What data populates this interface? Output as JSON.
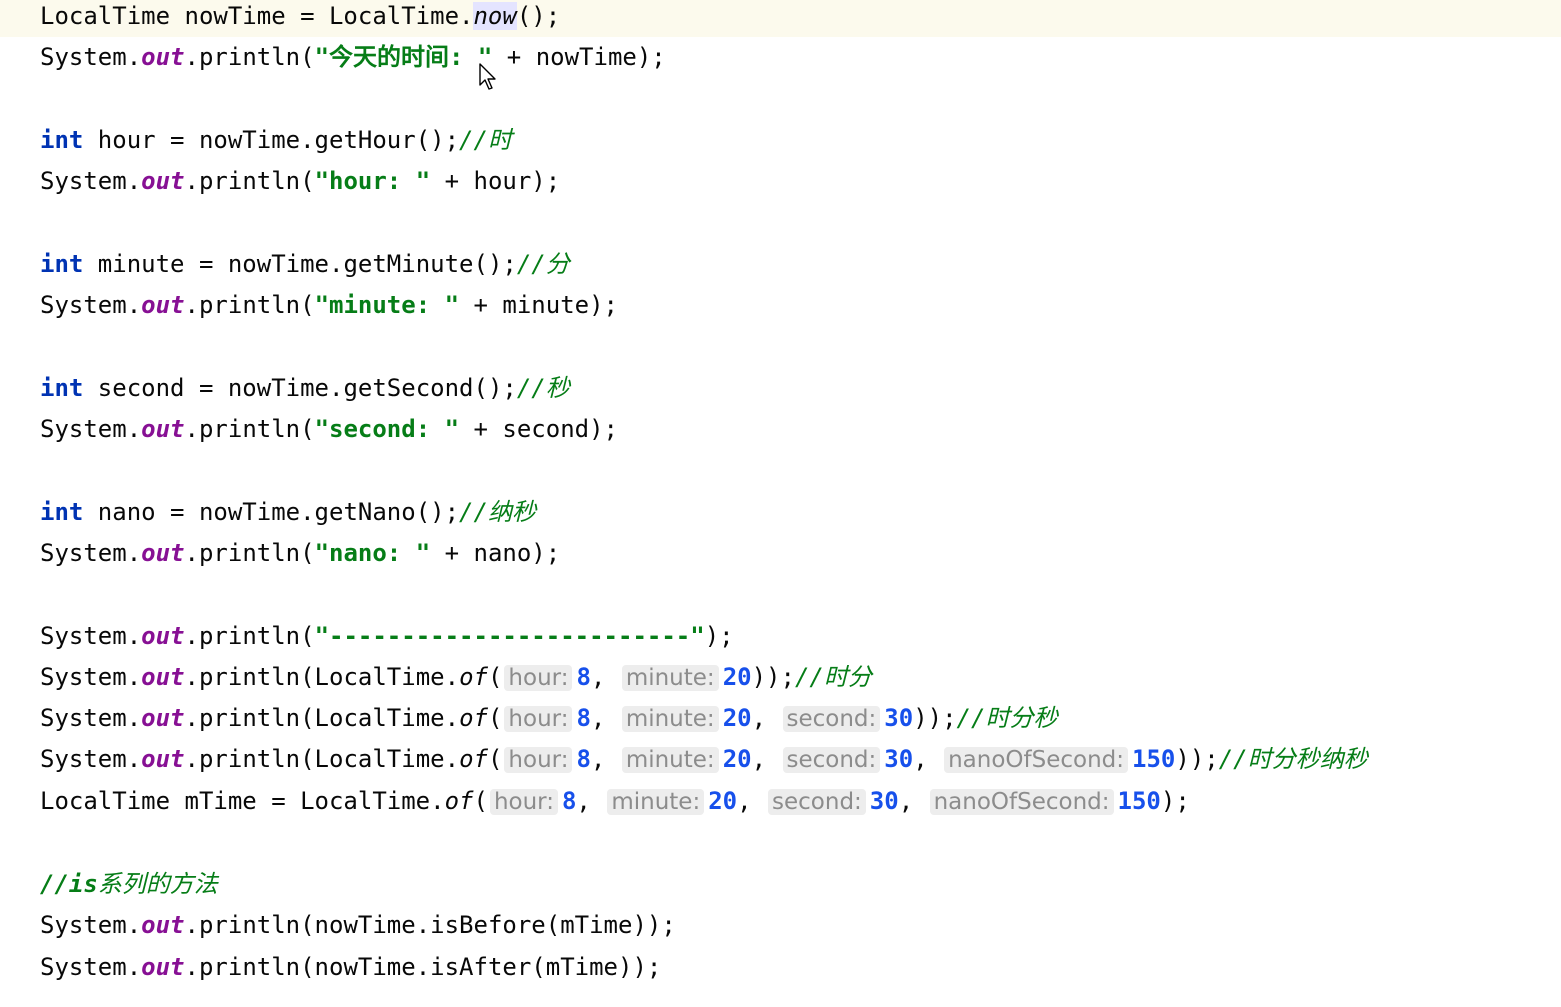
{
  "code": {
    "line1": {
      "t1": "LocalTime nowTime = LocalTime.",
      "m": "now",
      "t2": "();"
    },
    "line2": {
      "a": "System.",
      "f": "out",
      "b": ".println(",
      "s": "\"今天的时间: \"",
      "c": " + nowTime);"
    },
    "line4": {
      "kw": "int",
      "a": " hour = nowTime.getHour();",
      "cm": "//时"
    },
    "line5": {
      "a": "System.",
      "f": "out",
      "b": ".println(",
      "s": "\"hour: \"",
      "c": " + hour);"
    },
    "line7": {
      "kw": "int",
      "a": " minute = nowTime.getMinute();",
      "cm": "//分"
    },
    "line8": {
      "a": "System.",
      "f": "out",
      "b": ".println(",
      "s": "\"minute: \"",
      "c": " + minute);"
    },
    "line10": {
      "kw": "int",
      "a": " second = nowTime.getSecond();",
      "cm": "//秒"
    },
    "line11": {
      "a": "System.",
      "f": "out",
      "b": ".println(",
      "s": "\"second: \"",
      "c": " + second);"
    },
    "line13": {
      "kw": "int",
      "a": " nano = nowTime.getNano();",
      "cm": "//纳秒"
    },
    "line14": {
      "a": "System.",
      "f": "out",
      "b": ".println(",
      "s": "\"nano: \"",
      "c": " + nano);"
    },
    "line16": {
      "a": "System.",
      "f": "out",
      "b": ".println(",
      "s": "\"-------------------------\"",
      "c": ");"
    },
    "line17": {
      "a": "System.",
      "f": "out",
      "b": ".println(LocalTime.",
      "of": "of",
      "p": "(",
      "h1": "hour:",
      "v1": "8",
      "h2": "minute:",
      "v2": "20",
      "e": "));",
      "cm": "//时分"
    },
    "line18": {
      "a": "System.",
      "f": "out",
      "b": ".println(LocalTime.",
      "of": "of",
      "p": "(",
      "h1": "hour:",
      "v1": "8",
      "h2": "minute:",
      "v2": "20",
      "h3": "second:",
      "v3": "30",
      "e": "));",
      "cm": "//时分秒"
    },
    "line19": {
      "a": "System.",
      "f": "out",
      "b": ".println(LocalTime.",
      "of": "of",
      "p": "(",
      "h1": "hour:",
      "v1": "8",
      "h2": "minute:",
      "v2": "20",
      "h3": "second:",
      "v3": "30",
      "h4": "nanoOfSecond:",
      "v4": "150",
      "e": "));",
      "cm": "//时分秒纳秒"
    },
    "line20": {
      "a": "LocalTime mTime = LocalTime.",
      "of": "of",
      "p": "(",
      "h1": "hour:",
      "v1": "8",
      "h2": "minute:",
      "v2": "20",
      "h3": "second:",
      "v3": "30",
      "h4": "nanoOfSecond:",
      "v4": "150",
      "e": ");"
    },
    "line22": {
      "cm1": "//is",
      "cm2": "系列的方法"
    },
    "line23": {
      "a": "System.",
      "f": "out",
      "b": ".println(nowTime.isBefore(mTime));"
    },
    "line24": {
      "a": "System.",
      "f": "out",
      "b": ".println(nowTime.isAfter(mTime));"
    }
  },
  "punct": {
    "comma": ", "
  },
  "colors": {
    "keyword": "#0033b3",
    "field": "#871094",
    "string": "#067d17",
    "number": "#1750eb",
    "comment": "#8c8c8c",
    "current_line": "#fcfaed"
  },
  "icons": [
    "mouse-pointer-icon",
    "text-caret-icon"
  ]
}
